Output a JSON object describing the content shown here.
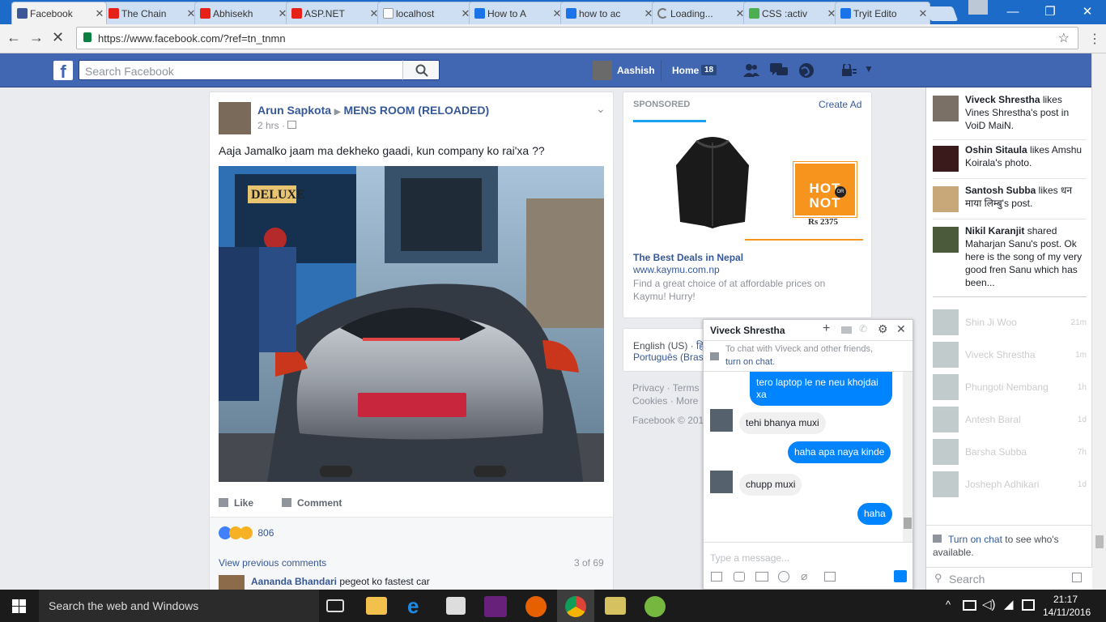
{
  "browser": {
    "tabs": [
      {
        "label": "Facebook",
        "color": "#3b5998"
      },
      {
        "label": "The Chain",
        "color": "#e62117"
      },
      {
        "label": "Abhisekh",
        "color": "#e62117"
      },
      {
        "label": "ASP.NET",
        "color": "#e62117"
      },
      {
        "label": "localhost",
        "color": "#9aa0a6"
      },
      {
        "label": "How to A",
        "color": "#1a73e8"
      },
      {
        "label": "how to ac",
        "color": "#1a73e8"
      },
      {
        "label": "Loading...",
        "color": "#9aa0a6"
      },
      {
        "label": "CSS :activ",
        "color": "#4caf50"
      },
      {
        "label": "Tryit Edito",
        "color": "#1a73e8"
      }
    ],
    "url": "https://www.facebook.com/?ref=tn_tnmn"
  },
  "fb": {
    "search_placeholder": "Search Facebook",
    "user": "Aashish",
    "home": "Home",
    "home_count": "18",
    "brand_color": "#4267b2"
  },
  "post": {
    "author": "Arun Sapkota",
    "group": "MENS ROOM (RELOADED)",
    "time": "2 hrs",
    "text": "Aaja Jamalko jaam ma dekheko gaadi, kun company ko rai'xa ??",
    "like": "Like",
    "comment": "Comment",
    "reactions": "806",
    "view_prev": "View previous comments",
    "count": "3 of 69",
    "c_author": "Aananda Bhandari",
    "c_text": "pegeot ko fastest car",
    "bus_sign": "DELUXE"
  },
  "ad": {
    "sponsored": "SPONSORED",
    "create": "Create Ad",
    "title": "The Best Deals in Nepal",
    "url": "www.kaymu.com.np",
    "desc": "Find a great choice of at affordable prices on Kaymu! Hurry!",
    "badge": "HOT NOT",
    "badge_or": "OR",
    "price": "Rs 2375"
  },
  "footer": {
    "lang1": "English (US)",
    "lang1b": "हि",
    "lang2": "Português (Bras",
    "privacy": "Privacy · Terms",
    "cookies": "Cookies · More",
    "copy": "Facebook © 201"
  },
  "ticker": [
    {
      "name": "Viveck Shrestha",
      "text": " likes Vines Shrestha's post in VoiD MaiN."
    },
    {
      "name": "Oshin Sitaula",
      "text": " likes Amshu Koirala's photo."
    },
    {
      "name": "Santosh Subba",
      "text": " likes धन माया लिम्बु's post."
    },
    {
      "name": "Nikil Karanjit",
      "text": " shared Maharjan Sanu's post. Ok here is the song of my very good fren Sanu which has been..."
    }
  ],
  "friends": [
    {
      "name": "Shin Ji Woo",
      "time": "21m"
    },
    {
      "name": "Viveck Shrestha",
      "time": "1m"
    },
    {
      "name": "Phungoti Nembang",
      "time": "1h"
    },
    {
      "name": "Antesh Baral",
      "time": "1d"
    },
    {
      "name": "Barsha Subba",
      "time": "7h"
    },
    {
      "name": "Josheph Adhikari",
      "time": "1d"
    }
  ],
  "sidebar": {
    "turn_on": "Turn on chat",
    "rest": " to see who's available.",
    "search": "Search"
  },
  "chat": {
    "name": "Viveck Shrestha",
    "notice": "To chat with Viveck and other friends,",
    "notice_link": "turn on chat.",
    "msgs": [
      "tero laptop le ne neu khojdai xa",
      "tehi bhanya muxi",
      "haha apa naya kinde",
      "chupp muxi",
      "haha"
    ],
    "placeholder": "Type a message..."
  },
  "taskbar": {
    "search": "Search the web and Windows",
    "time": "21:17",
    "date": "14/11/2016"
  }
}
